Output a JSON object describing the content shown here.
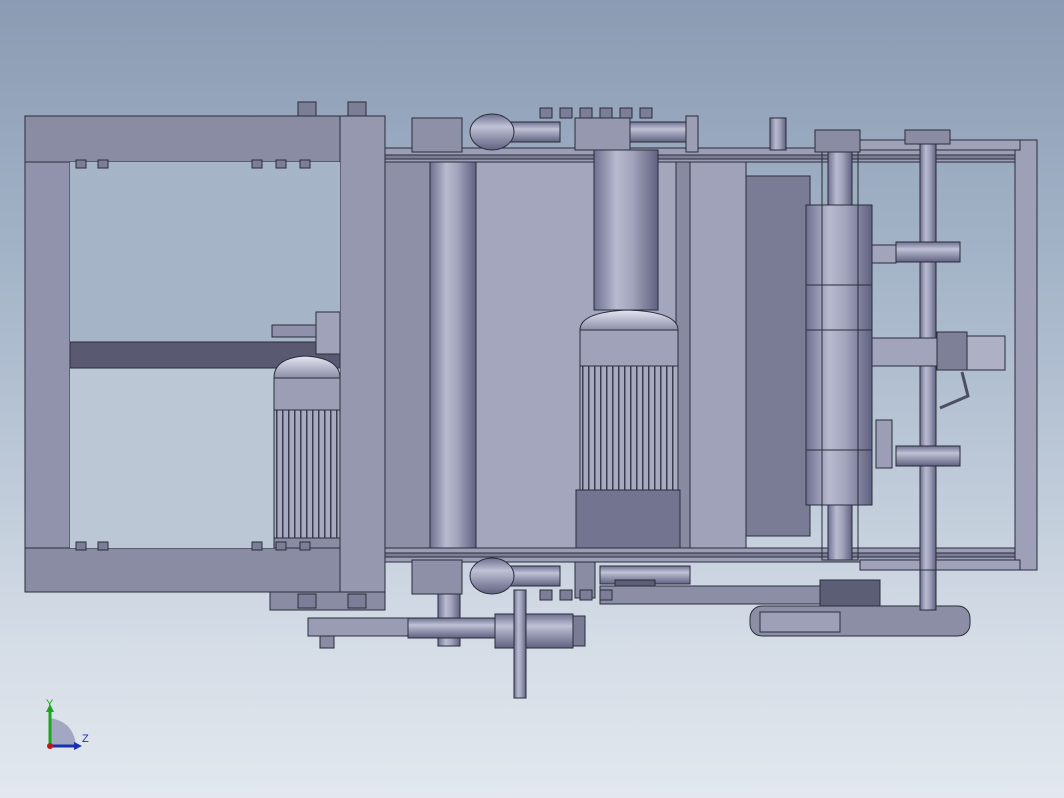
{
  "viewport": {
    "background_top": "#8a9bb3",
    "background_bottom": "#e2e8ee",
    "part_color": "#9a9cb4",
    "edge_color": "#2a2c3a"
  },
  "triad": {
    "y_label": "Y",
    "z_label": "Z",
    "y_color": "#1ea51e",
    "z_color": "#1b2fb0",
    "origin_color": "#c01818"
  }
}
